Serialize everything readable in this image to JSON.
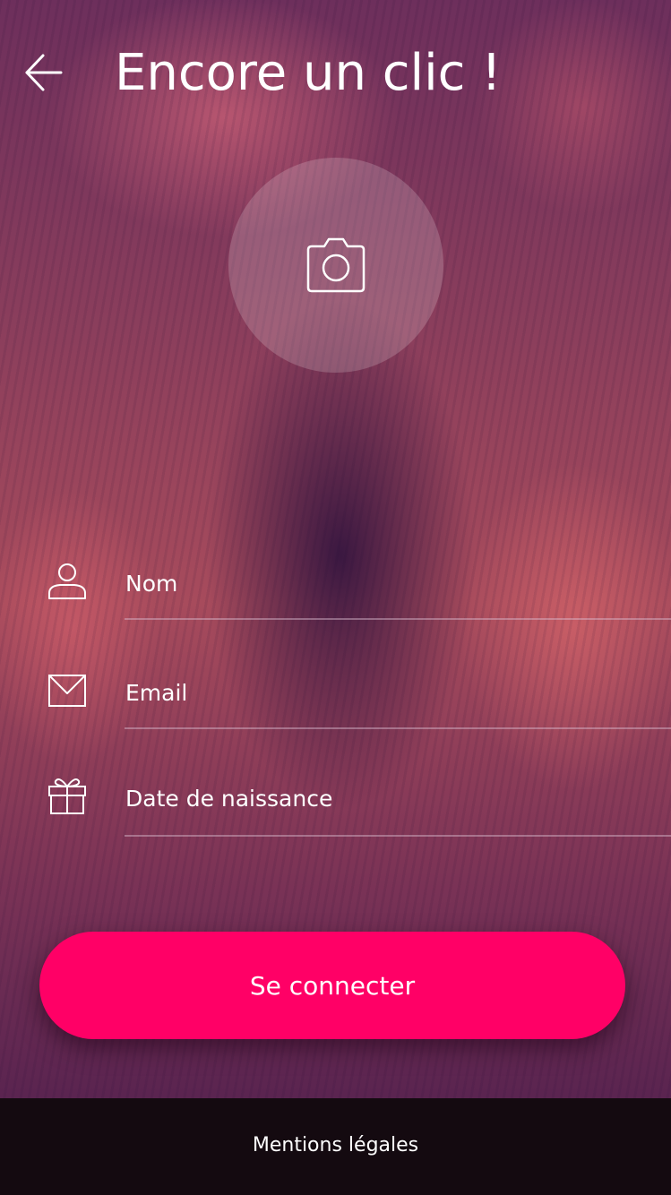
{
  "header": {
    "back_icon": "arrow-left-icon",
    "title": "Encore un clic !"
  },
  "avatar": {
    "icon": "camera-icon"
  },
  "form": {
    "name_placeholder": "Nom",
    "name_icon": "user-icon",
    "email_placeholder": "Email",
    "email_icon": "envelope-icon",
    "birthdate_placeholder": "Date de naissance",
    "birthdate_icon": "gift-icon"
  },
  "actions": {
    "connect_label": "Se connecter"
  },
  "footer": {
    "legal_label": "Mentions légales"
  },
  "colors": {
    "accent": "#ff0066",
    "footer_bg": "#140a10",
    "text": "#ffffff"
  }
}
